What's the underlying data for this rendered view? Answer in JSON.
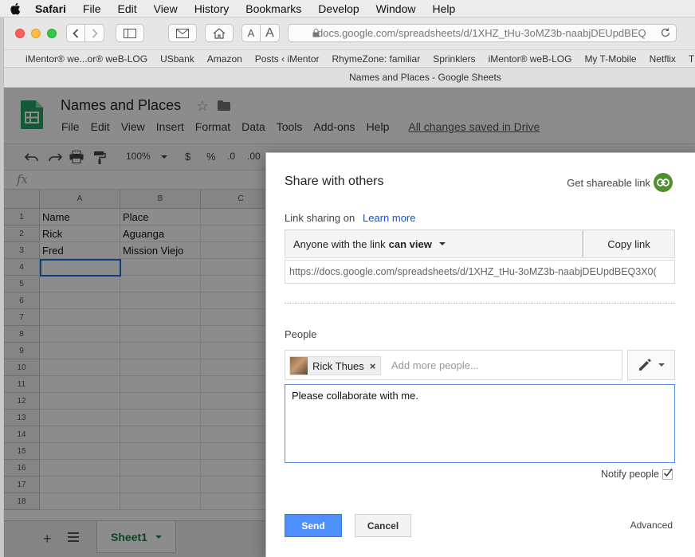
{
  "menubar": {
    "items": [
      "Safari",
      "File",
      "Edit",
      "View",
      "History",
      "Bookmarks",
      "Develop",
      "Window",
      "Help"
    ]
  },
  "browser": {
    "url": "docs.google.com/spreadsheets/d/1XHZ_tHu-3oMZ3b-naabjDEUpdBEQ",
    "text_size_small": "A",
    "text_size_large": "A",
    "bookmarks": [
      "iMentor® we...or® weB-LOG",
      "USbank",
      "Amazon",
      "Posts ‹ iMentor",
      "RhymeZone: familiar",
      "Sprinklers",
      "iMentor® weB-LOG",
      "My T-Mobile",
      "Netflix",
      "Th"
    ],
    "tab_title": "Names and Places - Google Sheets"
  },
  "sheets": {
    "doc_title": "Names and Places",
    "menu": [
      "File",
      "Edit",
      "View",
      "Insert",
      "Format",
      "Data",
      "Tools",
      "Add-ons",
      "Help"
    ],
    "saved_status": "All changes saved in Drive",
    "zoom": "100%",
    "currency": "$",
    "percent": "%",
    "dec_less": ".0",
    "dec_more": ".00",
    "columns": [
      "A",
      "B",
      "C"
    ],
    "rows": [
      "1",
      "2",
      "3",
      "4",
      "5",
      "6",
      "7",
      "8",
      "9",
      "10",
      "11",
      "12",
      "13",
      "14",
      "15",
      "16",
      "17",
      "18"
    ],
    "cells": [
      [
        "Name",
        "Place"
      ],
      [
        "Rick",
        "Aguanga"
      ],
      [
        "Fred",
        "Mission Viejo"
      ]
    ],
    "sheet_tab": "Sheet1"
  },
  "dialog": {
    "title": "Share with others",
    "shareable_link": "Get shareable link",
    "link_sharing_label": "Link sharing on",
    "learn_more": "Learn more",
    "permission_prefix": "Anyone with the link",
    "permission_value": "can view",
    "copy_link": "Copy link",
    "link_url": "https://docs.google.com/spreadsheets/d/1XHZ_tHu-3oMZ3b-naabjDEUpdBEQ3X0(",
    "people_label": "People",
    "person_name": "Rick Thues",
    "add_people_placeholder": "Add more people...",
    "message": "Please collaborate with me.",
    "notify_label": "Notify people",
    "notify_checked": true,
    "send": "Send",
    "cancel": "Cancel",
    "advanced": "Advanced"
  },
  "colors": {
    "send_blue": "#4d90fe",
    "link_blue": "#1155cc",
    "shareable_green": "#4f8f2f",
    "sheets_green": "#188038"
  }
}
